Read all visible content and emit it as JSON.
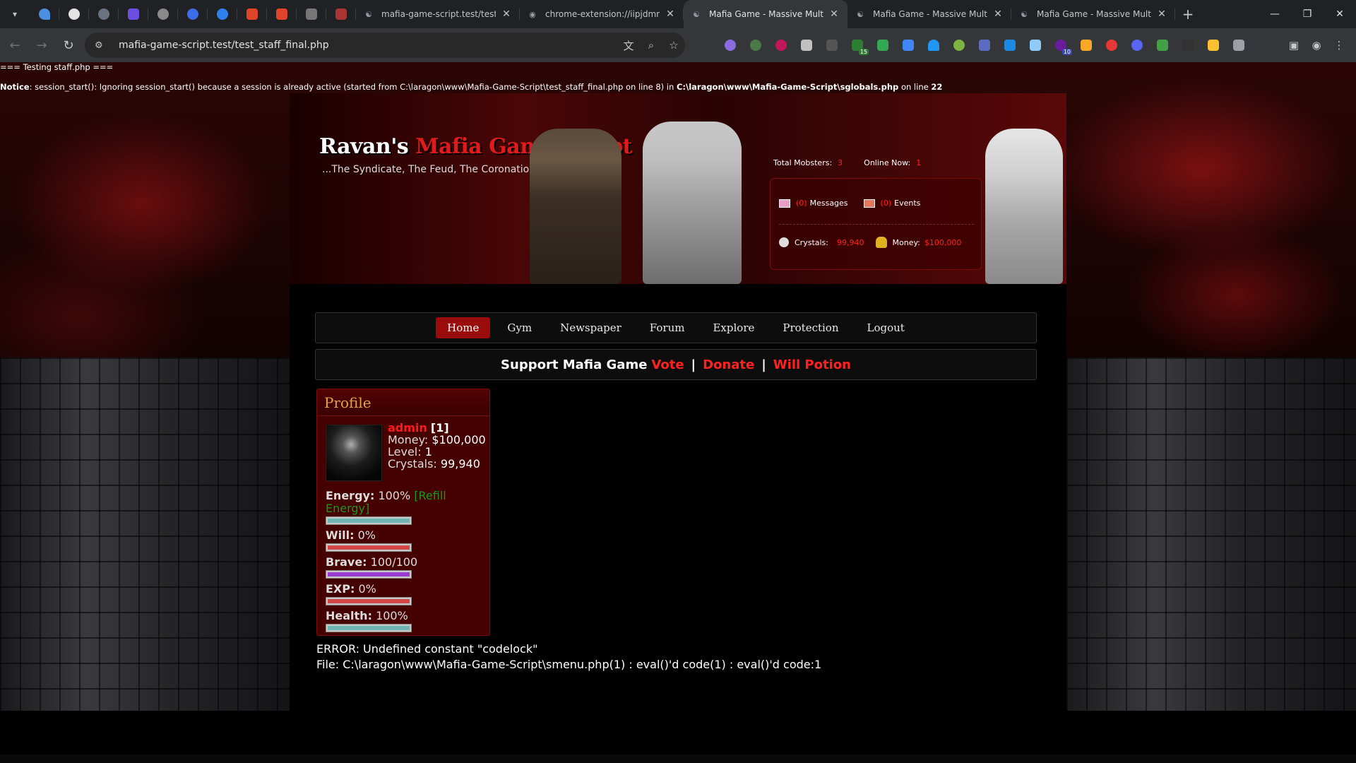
{
  "browser": {
    "tabs": [
      {
        "title": "mafia-game-script.test/test_st",
        "active": false
      },
      {
        "title": "chrome-extension://iipjdmno",
        "active": false
      },
      {
        "title": "Mafia Game - Massive Multipl",
        "active": true
      },
      {
        "title": "Mafia Game - Massive Multipl",
        "active": false
      },
      {
        "title": "Mafia Game - Massive Multipl",
        "active": false
      }
    ],
    "url": "mafia-game-script.test/test_staff_final.php",
    "ext_badge_1": "15",
    "ext_badge_2": "10",
    "pinned_icons": [
      "pin-icon",
      "github-icon",
      "globe-icon",
      "chat-icon",
      "web-icon",
      "c-icon",
      "c-icon",
      "shield-icon",
      "shield-icon",
      "script-icon",
      "mafia-icon"
    ]
  },
  "debug": {
    "line1": "=== Testing staff.php ===",
    "notice_label": "Notice",
    "notice_text": ": session_start(): Ignoring session_start() because a session is already active (started from C:\\laragon\\www\\Mafia-Game-Script\\test_staff_final.php on line 8) in ",
    "notice_file": "C:\\laragon\\www\\Mafia-Game-Script\\sglobals.php",
    "notice_online": " on line ",
    "notice_line": "22"
  },
  "header": {
    "logo_prefix": "Ravan's ",
    "logo_red": "Mafia Game Script",
    "tagline": "...The Syndicate, The Feud, The Coronation",
    "total_mobsters_label": "Total Mobsters:",
    "total_mobsters": "3",
    "online_now_label": "Online Now:",
    "online_now": "1",
    "messages_count": "(0)",
    "messages_label": "Messages",
    "events_count": "(0)",
    "events_label": "Events",
    "crystals_label": "Crystals:",
    "crystals": "99,940",
    "money_label": "Money:",
    "money": "$100,000"
  },
  "menu": {
    "items": [
      {
        "label": "Home",
        "active": true
      },
      {
        "label": "Gym",
        "active": false
      },
      {
        "label": "Newspaper",
        "active": false
      },
      {
        "label": "Forum",
        "active": false
      },
      {
        "label": "Explore",
        "active": false
      },
      {
        "label": "Protection",
        "active": false
      },
      {
        "label": "Logout",
        "active": false
      }
    ]
  },
  "support": {
    "prefix": "Support Mafia Game",
    "vote": "Vote",
    "donate": "Donate",
    "will_potion": "Will Potion",
    "sep": "|"
  },
  "profile": {
    "title": "Profile",
    "name": "admin",
    "id": "[1]",
    "money_label": "Money:",
    "money": "$100,000",
    "level_label": "Level:",
    "level": "1",
    "crystals_label": "Crystals:",
    "crystals": "99,940",
    "energy_label": "Energy:",
    "energy": "100%",
    "refill": "[Refill Energy]",
    "will_label": "Will:",
    "will": "0%",
    "brave_label": "Brave:",
    "brave": "100/100",
    "exp_label": "EXP:",
    "exp": "0%",
    "health_label": "Health:",
    "health": "100%",
    "bar_levels": {
      "energy": 1.0,
      "will": 0.0,
      "brave": 1.0,
      "exp": 0.0,
      "health": 1.0
    }
  },
  "error": {
    "line1": "ERROR: Undefined constant \"codelock\"",
    "line2": "File: C:\\laragon\\www\\Mafia-Game-Script\\smenu.php(1) : eval()'d code(1) : eval()'d code:1"
  },
  "colors": {
    "accent_red": "#ff2020",
    "menu_active": "#9a0b0b",
    "profile_bg": "#450000",
    "title_gold": "#e2a24a",
    "energy_bar": "#6fb5b5",
    "will_bar": "#d24040",
    "brave_bar": "#9a3ad0",
    "exp_bar": "#d24040",
    "health_bar": "#6fb5b5"
  }
}
